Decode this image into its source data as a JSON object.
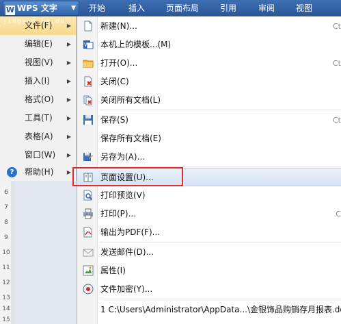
{
  "app": {
    "name": "WPS 文字"
  },
  "ribbon": {
    "tabs": [
      "开始",
      "插入",
      "页面布局",
      "引用",
      "审阅",
      "视图"
    ]
  },
  "left_menu": {
    "items": [
      {
        "label": "文件(F)"
      },
      {
        "label": "编辑(E)"
      },
      {
        "label": "视图(V)"
      },
      {
        "label": "插入(I)"
      },
      {
        "label": "格式(O)"
      },
      {
        "label": "工具(T)"
      },
      {
        "label": "表格(A)"
      },
      {
        "label": "窗口(W)"
      },
      {
        "label": "帮助(H)"
      }
    ]
  },
  "file_menu": {
    "items": [
      {
        "label": "新建(N)...",
        "shortcut": "Ct",
        "icon": "new-doc-icon"
      },
      {
        "label": "本机上的模板...(M)",
        "shortcut": "",
        "icon": "template-icon"
      },
      {
        "label": "打开(O)...",
        "shortcut": "Ct",
        "icon": "folder-open-icon"
      },
      {
        "label": "关闭(C)",
        "shortcut": "",
        "icon": "close-doc-icon"
      },
      {
        "label": "关闭所有文档(L)",
        "shortcut": "",
        "icon": "close-all-icon"
      },
      {
        "label": "保存(S)",
        "shortcut": "Ct",
        "icon": "save-icon"
      },
      {
        "label": "保存所有文档(E)",
        "shortcut": "",
        "icon": "save-all-icon"
      },
      {
        "label": "另存为(A)...",
        "shortcut": "",
        "icon": "save-as-icon"
      },
      {
        "label": "页面设置(U)...",
        "shortcut": "",
        "icon": "page-setup-icon"
      },
      {
        "label": "打印预览(V)",
        "shortcut": "",
        "icon": "print-preview-icon"
      },
      {
        "label": "打印(P)...",
        "shortcut": "C",
        "icon": "printer-icon"
      },
      {
        "label": "输出为PDF(F)...",
        "shortcut": "",
        "icon": "pdf-icon"
      },
      {
        "label": "发送邮件(D)...",
        "shortcut": "",
        "icon": "mail-icon"
      },
      {
        "label": "属性(I)",
        "shortcut": "",
        "icon": "properties-icon"
      },
      {
        "label": "文件加密(Y)...",
        "shortcut": "",
        "icon": "encrypt-icon"
      },
      {
        "label": "1 C:\\Users\\Administrator\\AppData...\\金银饰品购销存月报表.do",
        "shortcut": "",
        "icon": ""
      }
    ]
  },
  "ruler": {
    "numbers": [
      "6",
      "7",
      "8",
      "9",
      "10",
      "11",
      "12",
      "13",
      "14",
      "15"
    ]
  },
  "watermark": "jingyan.baidu"
}
